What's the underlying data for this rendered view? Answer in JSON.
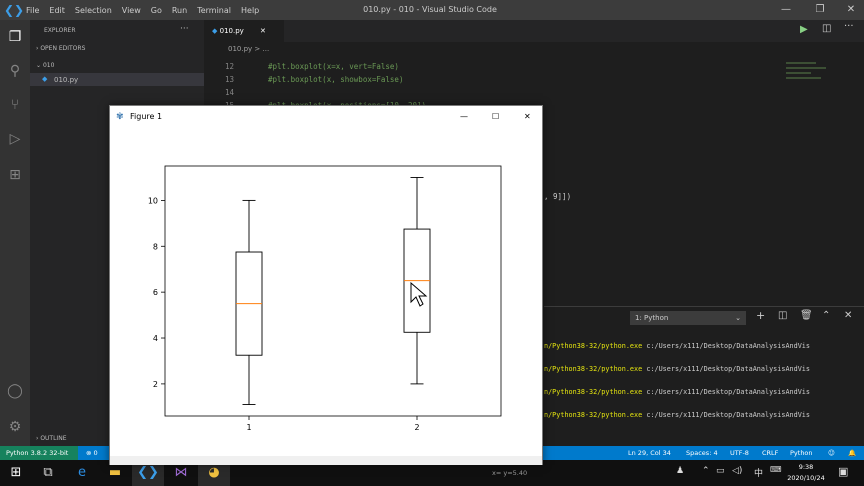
{
  "vscode": {
    "window_title": "010.py - 010 - Visual Studio Code",
    "menu": [
      "File",
      "Edit",
      "Selection",
      "View",
      "Go",
      "Run",
      "Terminal",
      "Help"
    ],
    "explorer_header": "EXPLORER",
    "open_editors": "OPEN EDITORS",
    "folder": "010",
    "file": "010.py",
    "outline": "OUTLINE",
    "tab": "010.py",
    "breadcrumb": "010.py > ...",
    "code": [
      {
        "n": "12",
        "text": "#plt.boxplot(x=x, vert=False)"
      },
      {
        "n": "13",
        "text": "#plt.boxplot(x, showbox=False)"
      },
      {
        "n": "14",
        "text": ""
      },
      {
        "n": "15",
        "text": "#plt.boxplot(x, positions=[10, 20])"
      }
    ],
    "code_fragment": ", 9]])",
    "terminal_select": "1: Python",
    "terminal_lines": [
      {
        "a": "n/Python38-32/python.exe ",
        "b": "c:/Users/x111/Desktop/DataAnalysisAndVis"
      },
      {
        "a": "n/Python38-32/python.exe ",
        "b": "c:/Users/x111/Desktop/DataAnalysisAndVis"
      },
      {
        "a": "n/Python38-32/python.exe ",
        "b": "c:/Users/x111/Desktop/DataAnalysisAndVis"
      },
      {
        "a": "n/Python38-32/python.exe ",
        "b": "c:/Users/x111/Desktop/DataAnalysisAndVis"
      }
    ],
    "status_left": "Python 3.8.2 32-bit",
    "status_errors": "⊗ 0",
    "status_right": [
      "Ln 29, Col 34",
      "Spaces: 4",
      "UTF-8",
      "CRLF",
      "Python"
    ],
    "status_coords": "x= y=5.40"
  },
  "taskbar": {
    "time": "9:38",
    "date": "2020/10/24",
    "ime": "中"
  },
  "figure": {
    "title": "Figure 1"
  },
  "chart_data": {
    "type": "boxplot",
    "categories": [
      "1",
      "2"
    ],
    "boxes": [
      {
        "label": "1",
        "whisker_low": 1.1,
        "q1": 3.25,
        "median": 5.5,
        "q3": 7.75,
        "whisker_high": 10
      },
      {
        "label": "2",
        "whisker_low": 2,
        "q1": 4.25,
        "median": 6.5,
        "q3": 8.75,
        "whisker_high": 11
      }
    ],
    "yticks": [
      2,
      4,
      6,
      8,
      10
    ],
    "ylim": [
      0.6,
      11.5
    ],
    "median_color": "#ff7f0e",
    "box_color": "#000000",
    "grid": false
  },
  "colors": {
    "accent": "#007acc",
    "background": "#1e1e1e",
    "sidebar": "#252526"
  }
}
